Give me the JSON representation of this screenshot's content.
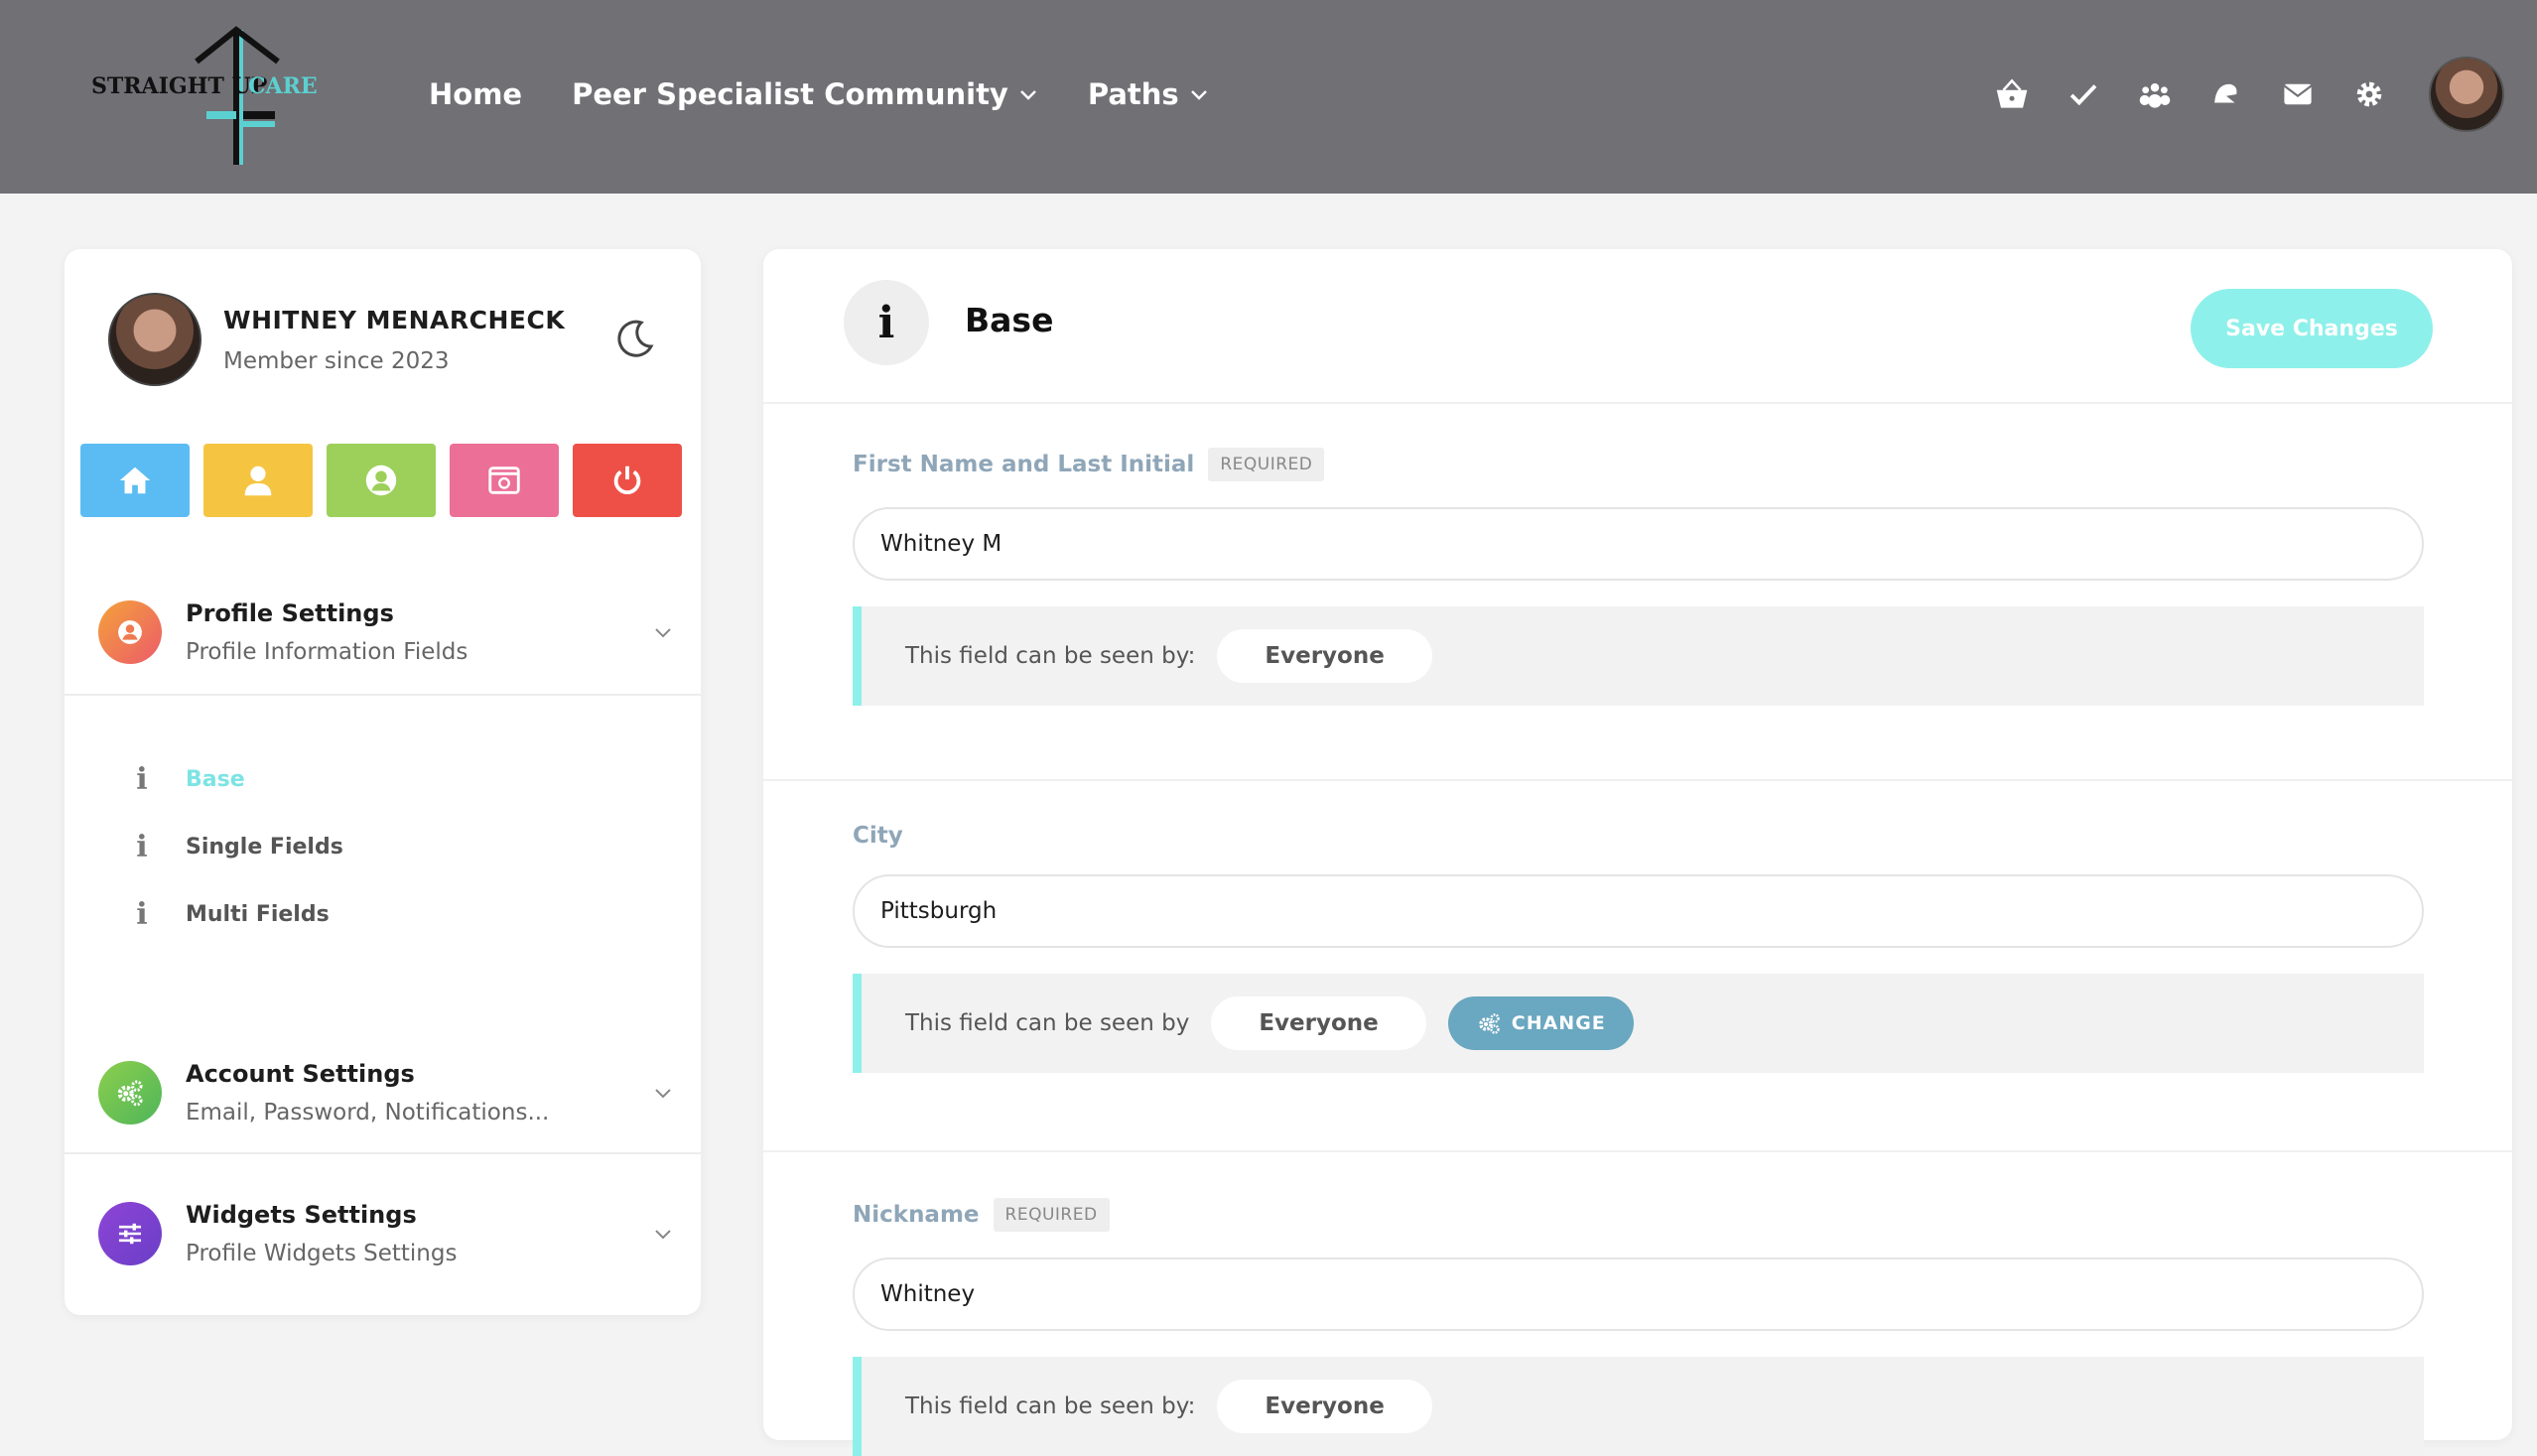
{
  "logo": {
    "text_left": "STRAIGHT UP",
    "text_right": "CARE"
  },
  "nav": {
    "home": "Home",
    "community": "Peer Specialist Community",
    "paths": "Paths"
  },
  "top_icons": [
    "basket-icon",
    "checkmark-icon",
    "groups-icon",
    "activity-icon",
    "mail-icon",
    "gear-icon"
  ],
  "profile": {
    "name": "WHITNEY MENARCHECK",
    "since": "Member since 2023"
  },
  "quick_buttons": [
    {
      "icon": "home-icon",
      "color": "#5bbcf3"
    },
    {
      "icon": "user-icon",
      "color": "#f5c542"
    },
    {
      "icon": "account-circle-icon",
      "color": "#9cd05a"
    },
    {
      "icon": "media-icon",
      "color": "#ec6f98"
    },
    {
      "icon": "power-icon",
      "color": "#ee5047"
    }
  ],
  "sections": {
    "profile": {
      "title": "Profile Settings",
      "sub": "Profile Information Fields"
    },
    "account": {
      "title": "Account Settings",
      "sub": "Email, Password, Notifications..."
    },
    "widgets": {
      "title": "Widgets Settings",
      "sub": "Profile Widgets Settings"
    }
  },
  "submenu": [
    "Base",
    "Single Fields",
    "Multi Fields"
  ],
  "main": {
    "title": "Base",
    "save_label": "Save Changes",
    "required_label": "REQUIRED",
    "fields": [
      {
        "label": "First Name and Last Initial",
        "value": "Whitney M",
        "vis_text": "This field can be seen by:",
        "vis_value": "Everyone"
      },
      {
        "label": "City",
        "value": "Pittsburgh",
        "vis_text": "This field can be seen by",
        "vis_value": "Everyone",
        "change_label": "CHANGE"
      },
      {
        "label": "Nickname",
        "value": "Whitney",
        "vis_text": "This field can be seen by:",
        "vis_value": "Everyone"
      }
    ]
  },
  "colors": {
    "accent": "#8ef0ea",
    "topbar": "#707075",
    "change": "#6aa7c0"
  }
}
